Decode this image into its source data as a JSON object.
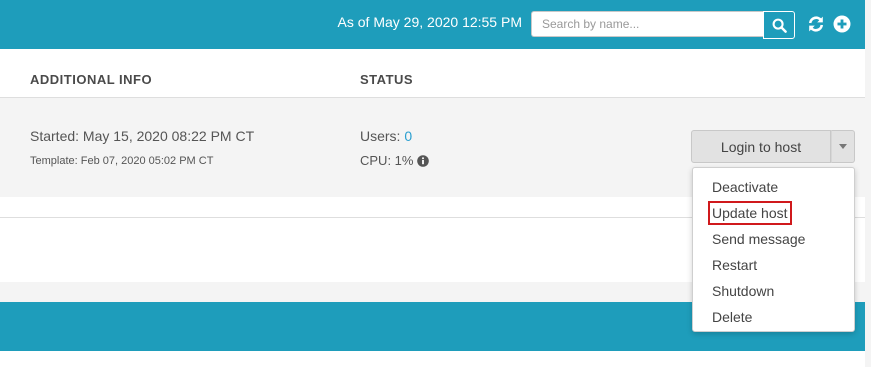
{
  "header": {
    "timestamp": "As of May 29, 2020 12:55 PM",
    "search_placeholder": "Search by name...",
    "icons": [
      "search-icon",
      "refresh-icon",
      "add-icon"
    ],
    "accent_color": "#1e9dbb"
  },
  "table": {
    "columns": [
      "ADDITIONAL INFO",
      "STATUS"
    ],
    "row": {
      "started": "Started: May 15, 2020 08:22 PM CT",
      "template": "Template: Feb 07, 2020 05:02 PM CT",
      "users_label": "Users: ",
      "users_value": "0",
      "cpu": "CPU: 1%",
      "login_button": "Login to host"
    }
  },
  "menu": {
    "items": [
      "Deactivate",
      "Update host",
      "Send message",
      "Restart",
      "Shutdown",
      "Delete"
    ],
    "highlighted_index": 1,
    "highlight_color": "#d0191c"
  }
}
